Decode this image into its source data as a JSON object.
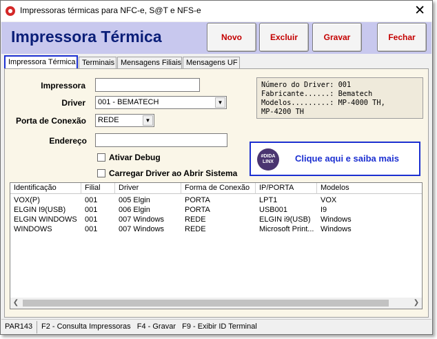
{
  "window": {
    "title": "Impressoras térmicas para NFC-e, S@T e NFS-e",
    "close_glyph": "✕"
  },
  "header": {
    "title": "Impressora Térmica",
    "buttons": {
      "novo": "Novo",
      "excluir": "Excluir",
      "gravar": "Gravar",
      "fechar": "Fechar"
    },
    "background_color": "#c8c8ee",
    "title_color": "#0a1e78",
    "button_text_color": "#c40000"
  },
  "tabs": [
    {
      "label": "Impressora Térmica",
      "active": true
    },
    {
      "label": "Terminais",
      "active": false
    },
    {
      "label": "Mensagens Filiais",
      "active": false
    },
    {
      "label": "Mensagens UF",
      "active": false
    }
  ],
  "form": {
    "impressora_label": "Impressora",
    "impressora_value": "",
    "driver_label": "Driver",
    "driver_value": "001 - BEMATECH",
    "porta_label": "Porta de Conexão",
    "porta_value": "REDE",
    "endereco_label": "Endereço",
    "endereco_value": "",
    "ativar_debug_label": "Ativar Debug",
    "ativar_debug_checked": false,
    "carregar_driver_label": "Carregar Driver ao Abrir Sistema",
    "carregar_driver_checked": false
  },
  "info": {
    "lines": [
      "Número do Driver: 001",
      "Fabricante......: Bematech",
      "Modelos.........: MP-4000 TH,",
      "MP-4200 TH"
    ]
  },
  "promo": {
    "logo_text": "DIDA LINX",
    "text": "Clique aqui e saiba mais",
    "accent": "#1b2fd1"
  },
  "grid": {
    "columns": [
      "Identificação",
      "Filial",
      "Driver",
      "Forma de Conexão",
      "IP/PORTA",
      "Modelos"
    ],
    "rows": [
      [
        "VOX(P)",
        "001",
        "005 Elgin",
        "PORTA",
        "LPT1",
        "VOX"
      ],
      [
        "ELGIN I9(USB)",
        "001",
        "006 Elgin",
        "PORTA",
        "USB001",
        "I9"
      ],
      [
        "ELGIN WINDOWS",
        "001",
        "007 Windows",
        "REDE",
        "ELGIN i9(USB)",
        "Windows"
      ],
      [
        "WINDOWS",
        "001",
        "007 Windows",
        "REDE",
        "Microsoft Print...",
        "Windows"
      ]
    ]
  },
  "status": {
    "code": "PAR143",
    "shortcuts": "F2 - Consulta Impressoras   F4 - Gravar   F9 - Exibir ID Terminal"
  }
}
